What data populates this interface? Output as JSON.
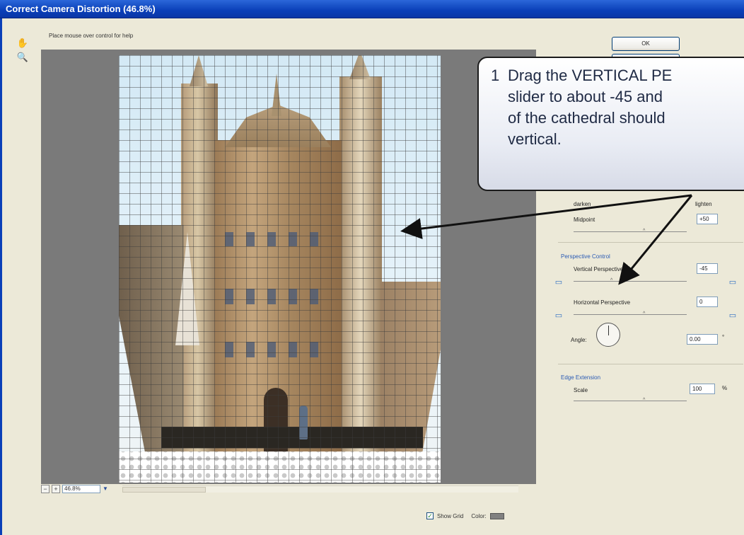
{
  "window": {
    "title": "Correct Camera Distortion (46.8%)"
  },
  "tools": {
    "hand": "hand-icon",
    "zoom": "zoom-icon"
  },
  "help": {
    "text": "Place mouse over control for help"
  },
  "buttons": {
    "ok": "OK"
  },
  "zoom": {
    "minus": "−",
    "plus": "+",
    "value": "46.8%",
    "dropdown": "▼"
  },
  "options": {
    "show_grid_check": "✓",
    "show_grid": "Show Grid",
    "color": "Color:",
    "grid_color": "#808080"
  },
  "vignette": {
    "darken": "darken",
    "lighten": "lighten",
    "midpoint_label": "Midpoint",
    "midpoint_value": "+50"
  },
  "perspective": {
    "title": "Perspective Control",
    "vertical_label": "Vertical Perspective",
    "vertical_value": "-45",
    "horizontal_label": "Horizontal Perspective",
    "horizontal_value": "0",
    "angle_label": "Angle:",
    "angle_value": "0.00",
    "degree": "°"
  },
  "edge": {
    "title": "Edge Extension",
    "scale_label": "Scale",
    "scale_value": "100",
    "percent": "%"
  },
  "callout": {
    "number": "1",
    "line1": "Drag the VERTICAL PE",
    "line2": "slider to about -45 and",
    "line3": "of the cathedral should",
    "line4": "vertical."
  }
}
